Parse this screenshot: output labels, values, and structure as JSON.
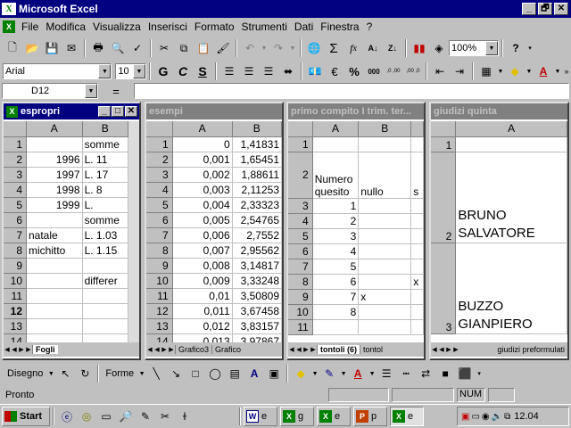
{
  "app": {
    "title": "Microsoft Excel",
    "controls": [
      "_",
      "🗗",
      "✕"
    ]
  },
  "menu": [
    "File",
    "Modifica",
    "Visualizza",
    "Inserisci",
    "Formato",
    "Strumenti",
    "Dati",
    "Finestra",
    "?"
  ],
  "toolbar": {
    "zoom": "100%"
  },
  "format": {
    "font": "Arial",
    "size": "10",
    "bold": "G",
    "italic": "C",
    "underline": "S",
    "euro": "€",
    "percent": "%",
    "thousands": "000",
    "dec_add": ",0 ,00",
    "dec_remove": ",00 ,0"
  },
  "formula": {
    "namebox": "D12",
    "equals": "="
  },
  "windows": {
    "espropri": {
      "title": "espropri",
      "cols": [
        "A",
        "B"
      ],
      "rows": [
        {
          "n": "1",
          "a": "",
          "b": "somme"
        },
        {
          "n": "2",
          "a": "1996",
          "b": "L.    11"
        },
        {
          "n": "3",
          "a": "1997",
          "b": "L.    17"
        },
        {
          "n": "4",
          "a": "1998",
          "b": "L.      8"
        },
        {
          "n": "5",
          "a": "1999",
          "b": "L."
        },
        {
          "n": "6",
          "a": "",
          "b": "somme"
        },
        {
          "n": "7",
          "a": "natale",
          "b": "L. 1.03"
        },
        {
          "n": "8",
          "a": "michitto",
          "b": "L. 1.15"
        },
        {
          "n": "9",
          "a": "",
          "b": ""
        },
        {
          "n": "10",
          "a": "",
          "b": "differer"
        },
        {
          "n": "11",
          "a": "",
          "b": ""
        },
        {
          "n": "12",
          "a": "",
          "b": ""
        },
        {
          "n": "13",
          "a": "",
          "b": ""
        },
        {
          "n": "14",
          "a": "",
          "b": ""
        }
      ],
      "tabs": [
        "Fogli"
      ]
    },
    "esempi": {
      "title": "esempi",
      "cols": [
        "A",
        "B"
      ],
      "rows": [
        {
          "n": "1",
          "a": "0",
          "b": "1,41831"
        },
        {
          "n": "2",
          "a": "0,001",
          "b": "1,65451"
        },
        {
          "n": "3",
          "a": "0,002",
          "b": "1,88611"
        },
        {
          "n": "4",
          "a": "0,003",
          "b": "2,11253"
        },
        {
          "n": "5",
          "a": "0,004",
          "b": "2,33323"
        },
        {
          "n": "6",
          "a": "0,005",
          "b": "2,54765"
        },
        {
          "n": "7",
          "a": "0,006",
          "b": "2,7552"
        },
        {
          "n": "8",
          "a": "0,007",
          "b": "2,95562"
        },
        {
          "n": "9",
          "a": "0,008",
          "b": "3,14817"
        },
        {
          "n": "10",
          "a": "0,009",
          "b": "3,33248"
        },
        {
          "n": "11",
          "a": "0,01",
          "b": "3,50809"
        },
        {
          "n": "12",
          "a": "0,011",
          "b": "3,67458"
        },
        {
          "n": "13",
          "a": "0,012",
          "b": "3,83157"
        },
        {
          "n": "14",
          "a": "0,013",
          "b": "3,97867"
        }
      ],
      "tabs": [
        "Grafico3",
        "Grafico"
      ]
    },
    "compito": {
      "title": "primo compito I trim. ter...",
      "cols": [
        "A",
        "B"
      ],
      "rows": [
        {
          "n": "1",
          "a": "",
          "b": ""
        },
        {
          "n": "2",
          "a": "Numero quesito",
          "b": "nullo",
          "c": "s"
        },
        {
          "n": "3",
          "a": "1",
          "b": ""
        },
        {
          "n": "4",
          "a": "2",
          "b": ""
        },
        {
          "n": "5",
          "a": "3",
          "b": ""
        },
        {
          "n": "6",
          "a": "4",
          "b": ""
        },
        {
          "n": "7",
          "a": "5",
          "b": ""
        },
        {
          "n": "8",
          "a": "6",
          "b": "",
          "c": "x"
        },
        {
          "n": "9",
          "a": "7",
          "b": "x"
        },
        {
          "n": "10",
          "a": "8",
          "b": ""
        },
        {
          "n": "11",
          "a": "",
          "b": ""
        }
      ],
      "tabs": [
        "tontoli (6)",
        "tontol"
      ]
    },
    "giudizi": {
      "title": "giudizi quinta",
      "cols": [
        "A"
      ],
      "rows": [
        {
          "n": "1",
          "a1": "",
          "a2": ""
        },
        {
          "n": "2",
          "a1": "BRUNO",
          "a2": "SALVATORE"
        },
        {
          "n": "3",
          "a1": "BUZZO",
          "a2": "GIANPIERO"
        }
      ],
      "tabs": [
        "giudizi preformulati"
      ]
    }
  },
  "drawing": {
    "draw": "Disegno",
    "shapes": "Forme"
  },
  "status": {
    "text": "Pronto",
    "num": "NUM"
  },
  "taskbar": {
    "start": "Start",
    "tasks": [
      "e",
      "g",
      "e",
      "p",
      "e"
    ],
    "clock": "12.04"
  },
  "colors": {
    "title_active": "#000080",
    "title_inactive": "#808080",
    "face": "#c0c0c0",
    "excel_green": "#008000"
  }
}
